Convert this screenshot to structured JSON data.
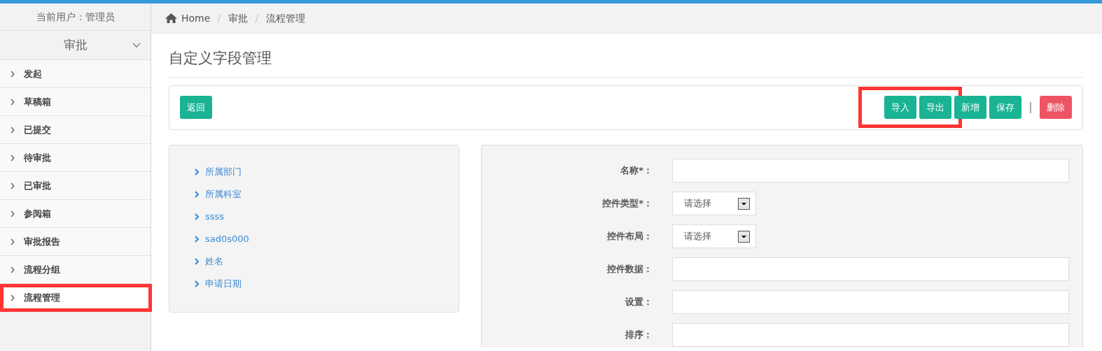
{
  "sidebar": {
    "user": "当前用户：管理员",
    "group": {
      "label": "审批",
      "expanded": true
    },
    "items": [
      {
        "label": "发起",
        "selected": false,
        "highlighted": false
      },
      {
        "label": "草稿箱",
        "selected": false,
        "highlighted": false
      },
      {
        "label": "已提交",
        "selected": false,
        "highlighted": false
      },
      {
        "label": "待审批",
        "selected": false,
        "highlighted": false
      },
      {
        "label": "已审批",
        "selected": false,
        "highlighted": false
      },
      {
        "label": "参阅箱",
        "selected": false,
        "highlighted": false
      },
      {
        "label": "审批报告",
        "selected": false,
        "highlighted": false
      },
      {
        "label": "流程分组",
        "selected": false,
        "highlighted": false
      },
      {
        "label": "流程管理",
        "selected": true,
        "highlighted": true
      }
    ]
  },
  "breadcrumb": [
    "Home",
    "审批",
    "流程管理"
  ],
  "page_title": "自定义字段管理",
  "toolbar": {
    "left": [
      {
        "label": "返回",
        "kind": "success",
        "highlighted": false
      }
    ],
    "right": [
      {
        "label": "导入",
        "kind": "success",
        "highlighted": true
      },
      {
        "label": "导出",
        "kind": "success",
        "highlighted": true
      },
      {
        "label": "新增",
        "kind": "success",
        "highlighted": false
      },
      {
        "label": "保存",
        "kind": "success",
        "highlighted": false
      },
      {
        "kind": "separator"
      },
      {
        "label": "删除",
        "kind": "danger",
        "highlighted": false
      }
    ]
  },
  "field_list": [
    "所属部门",
    "所属科室",
    "ssss",
    "sad0s000",
    "姓名",
    "申请日期"
  ],
  "form": [
    {
      "label": "名称*：",
      "kind": "text"
    },
    {
      "label": "控件类型*：",
      "kind": "select",
      "value": "请选择"
    },
    {
      "label": "控件布局：",
      "kind": "select",
      "value": "请选择"
    },
    {
      "label": "控件数据：",
      "kind": "text"
    },
    {
      "label": "设置：",
      "kind": "text"
    },
    {
      "label": "排序：",
      "kind": "text"
    }
  ]
}
